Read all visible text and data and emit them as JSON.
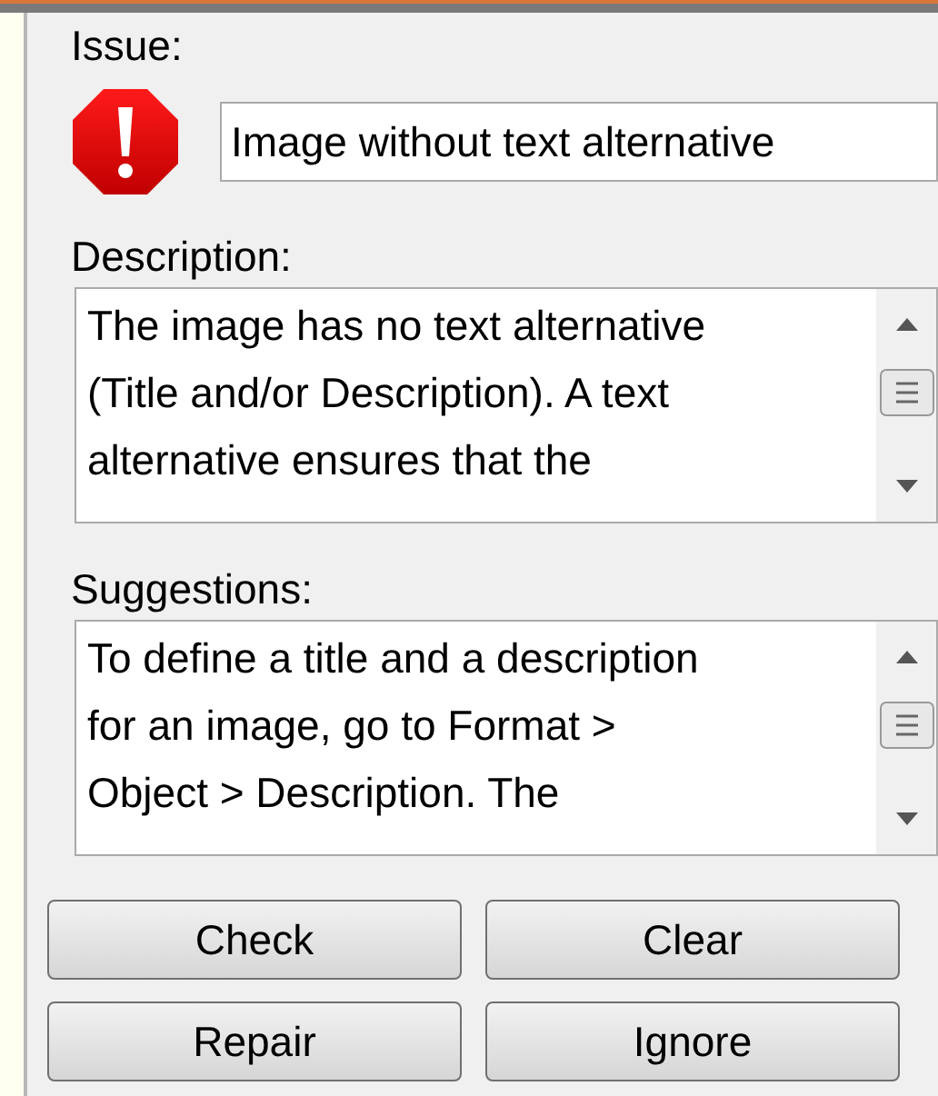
{
  "issue": {
    "label": "Issue:",
    "value": "Image without text alternative",
    "kind": "error"
  },
  "description": {
    "label": "Description:",
    "lines": [
      "The image has no text alternative",
      "(Title and/or Description). A text",
      "alternative ensures that the"
    ]
  },
  "suggestions": {
    "label": "Suggestions:",
    "lines": [
      "To define a title and a description",
      "for an image, go to Format >",
      "Object > Description. The"
    ]
  },
  "buttons": [
    "Check",
    "Clear",
    "Repair",
    "Ignore"
  ]
}
